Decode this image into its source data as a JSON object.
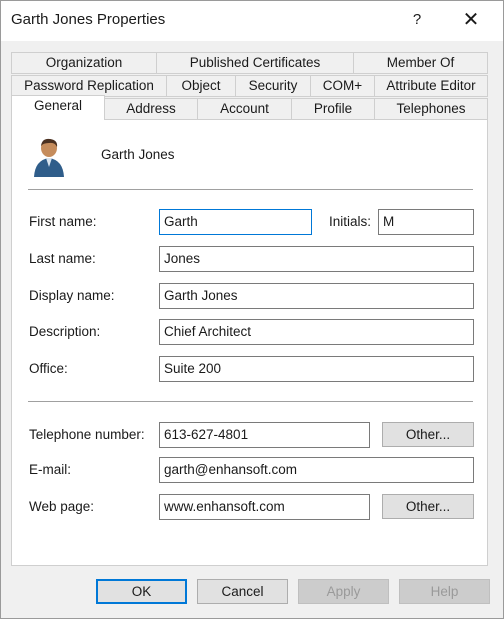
{
  "window": {
    "title": "Garth Jones Properties",
    "help_glyph": "?",
    "close_glyph": "✕"
  },
  "tabs": {
    "row1": [
      "Organization",
      "Published Certificates",
      "Member Of"
    ],
    "row2": [
      "Password Replication",
      "Object",
      "Security",
      "COM+",
      "Attribute Editor"
    ],
    "row3": [
      "General",
      "Address",
      "Account",
      "Profile",
      "Telephones"
    ],
    "active": "General"
  },
  "general": {
    "display_name_header": "Garth Jones",
    "fields": {
      "first_name": {
        "label": "First name:",
        "value": "Garth"
      },
      "initials": {
        "label": "Initials:",
        "value": "M"
      },
      "last_name": {
        "label": "Last name:",
        "value": "Jones"
      },
      "display_name": {
        "label": "Display name:",
        "value": "Garth Jones"
      },
      "description": {
        "label": "Description:",
        "value": "Chief Architect"
      },
      "office": {
        "label": "Office:",
        "value": "Suite 200"
      },
      "telephone": {
        "label": "Telephone number:",
        "value": "613-627-4801"
      },
      "email": {
        "label": "E-mail:",
        "value": "garth@enhansoft.com"
      },
      "web_page": {
        "label": "Web page:",
        "value": "www.enhansoft.com"
      }
    },
    "other_label": "Other..."
  },
  "buttons": {
    "ok": "OK",
    "cancel": "Cancel",
    "apply": "Apply",
    "help": "Help"
  },
  "colors": {
    "focus": "#0078d7",
    "window_bg": "#f0f0f0",
    "panel_bg": "#ffffff"
  }
}
